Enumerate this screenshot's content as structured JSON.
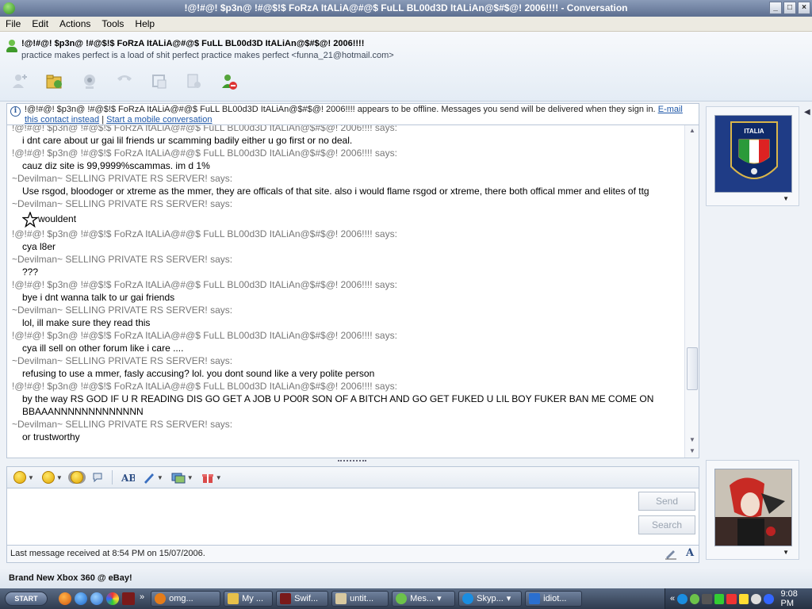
{
  "window": {
    "title": "!@!#@! $p3n@ !#@$!$ FoRzA ItALiA@#@$ FuLL BL00d3D ItALiAn@$#$@! 2006!!!! - Conversation",
    "minimize": "_",
    "maximize": "□",
    "close": "×"
  },
  "menu": [
    "File",
    "Edit",
    "Actions",
    "Tools",
    "Help"
  ],
  "contact": {
    "name": "!@!#@! $p3n@ !#@$!$ FoRzA ItALiA@#@$ FuLL BL00d3D ItALiAn@$#$@! 2006!!!!",
    "personal_message": "practice makes perfect is a load of shit perfect practice makes perfect <funna_21@hotmail.com>"
  },
  "toolbar": {
    "icons": [
      "invite-contact-icon",
      "send-files-icon",
      "webcam-icon",
      "call-icon",
      "activities-icon",
      "games-icon",
      "block-contact-icon"
    ]
  },
  "notice": {
    "text": "!@!#@! $p3n@ !#@$!$ FoRzA ItALiA@#@$ FuLL BL00d3D ItALiAn@$#$@! 2006!!!! appears to be offline. Messages you send will be delivered when they sign in.",
    "email_link": "E-mail this contact instead",
    "separator": "|",
    "mobile_link": "Start a mobile conversation"
  },
  "messages": [
    {
      "sender": "!@!#@! $p3n@ !#@$!$ FoRzA ItALiA@#@$ FuLL BL00d3D ItALiAn@$#$@! 2006!!!! says:",
      "text": "i dnt care about ur gai lil friends ur scamming badily either u go first or no deal."
    },
    {
      "sender": "!@!#@! $p3n@ !#@$!$ FoRzA ItALiA@#@$ FuLL BL00d3D ItALiAn@$#$@! 2006!!!! says:",
      "text": "cauz diz site is 99,9999%scammas. im d 1%"
    },
    {
      "sender": "~Devilman~  SELLING PRIVATE RS SERVER! says:",
      "text": "Use rsgod, bloodoger or xtreme as the mmer, they are officals of that site. also i would flame rsgod or xtreme, there both offical mmer and elites of ttg"
    },
    {
      "sender": "~Devilman~  SELLING PRIVATE RS SERVER! says:",
      "text": "wouldent",
      "emoticon": "star-emoticon"
    },
    {
      "sender": "!@!#@! $p3n@ !#@$!$ FoRzA ItALiA@#@$ FuLL BL00d3D ItALiAn@$#$@! 2006!!!! says:",
      "text": "cya l8er"
    },
    {
      "sender": "~Devilman~  SELLING PRIVATE RS SERVER! says:",
      "text": "???"
    },
    {
      "sender": "!@!#@! $p3n@ !#@$!$ FoRzA ItALiA@#@$ FuLL BL00d3D ItALiAn@$#$@! 2006!!!! says:",
      "text": "bye i dnt wanna talk to ur gai friends"
    },
    {
      "sender": "~Devilman~  SELLING PRIVATE RS SERVER! says:",
      "text": "lol, ill make sure they read this"
    },
    {
      "sender": "!@!#@! $p3n@ !#@$!$ FoRzA ItALiA@#@$ FuLL BL00d3D ItALiAn@$#$@! 2006!!!! says:",
      "text": "cya ill sell on other forum like i care ...."
    },
    {
      "sender": "~Devilman~  SELLING PRIVATE RS SERVER! says:",
      "text": "refusing to use a mmer, fasly accusing? lol. you dont sound like a very polite person"
    },
    {
      "sender": "!@!#@! $p3n@ !#@$!$ FoRzA ItALiA@#@$ FuLL BL00d3D ItALiAn@$#$@! 2006!!!! says:",
      "text": "by the way RS GOD IF U R READING DIS GO GET A JOB U PO0R SON OF A BITCH AND GO GET FUKED U LIL BOY FUKER BAN ME COME ON BBAAANNNNNNNNNNNNN"
    },
    {
      "sender": "~Devilman~  SELLING PRIVATE RS SERVER! says:",
      "text": "or trustworthy"
    }
  ],
  "compose": {
    "icons": [
      "emoticon-icon",
      "wink-icon",
      "nudge-icon",
      "voice-clip-icon",
      "font-icon",
      "background-icon",
      "picture-icon",
      "gift-icon"
    ],
    "input_value": "",
    "send_label": "Send",
    "search_label": "Search"
  },
  "status": {
    "last_message": "Last message received at 8:54 PM on 15/07/2006."
  },
  "ad": {
    "text": "Brand New Xbox 360 @ eBay!"
  },
  "display_pictures": {
    "contact_caption": "ITALIA"
  },
  "taskbar": {
    "start_label": "START",
    "more_label": "»",
    "tasks": [
      "omg...",
      "My ...",
      "Swif...",
      "untit...",
      "Mes...",
      "Skyp...",
      "idiot..."
    ],
    "clock": "9:08 PM"
  }
}
